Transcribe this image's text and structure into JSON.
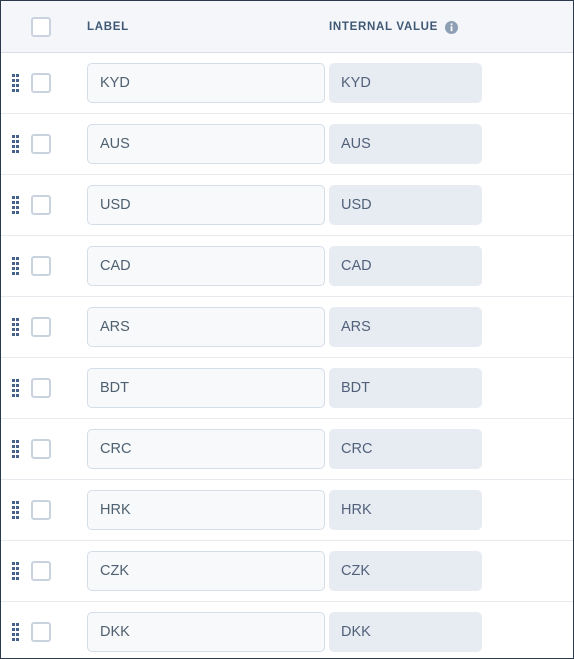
{
  "table": {
    "columns": {
      "label_header": "LABEL",
      "internal_value_header": "INTERNAL VALUE",
      "internal_value_info_icon": "info-icon",
      "select_all_checkbox": "select-all",
      "drag_handle_icon": "drag-handle-icon"
    },
    "rows": [
      {
        "label": "KYD",
        "internal_value": "KYD",
        "checked": false
      },
      {
        "label": "AUS",
        "internal_value": "AUS",
        "checked": false
      },
      {
        "label": "USD",
        "internal_value": "USD",
        "checked": false
      },
      {
        "label": "CAD",
        "internal_value": "CAD",
        "checked": false
      },
      {
        "label": "ARS",
        "internal_value": "ARS",
        "checked": false
      },
      {
        "label": "BDT",
        "internal_value": "BDT",
        "checked": false
      },
      {
        "label": "CRC",
        "internal_value": "CRC",
        "checked": false
      },
      {
        "label": "HRK",
        "internal_value": "HRK",
        "checked": false
      },
      {
        "label": "CZK",
        "internal_value": "CZK",
        "checked": false
      },
      {
        "label": "DKK",
        "internal_value": "DKK",
        "checked": false
      }
    ]
  },
  "colors": {
    "header_bg": "#f4f6f9",
    "header_text": "#3e5875",
    "input_bg": "#f7f9fb",
    "input_border": "#d5dde8",
    "readonly_bg": "#e7ebf2",
    "handle_dot": "#46618a",
    "checkbox_border": "#c9d3e0",
    "row_divider": "#e7ebf0"
  }
}
